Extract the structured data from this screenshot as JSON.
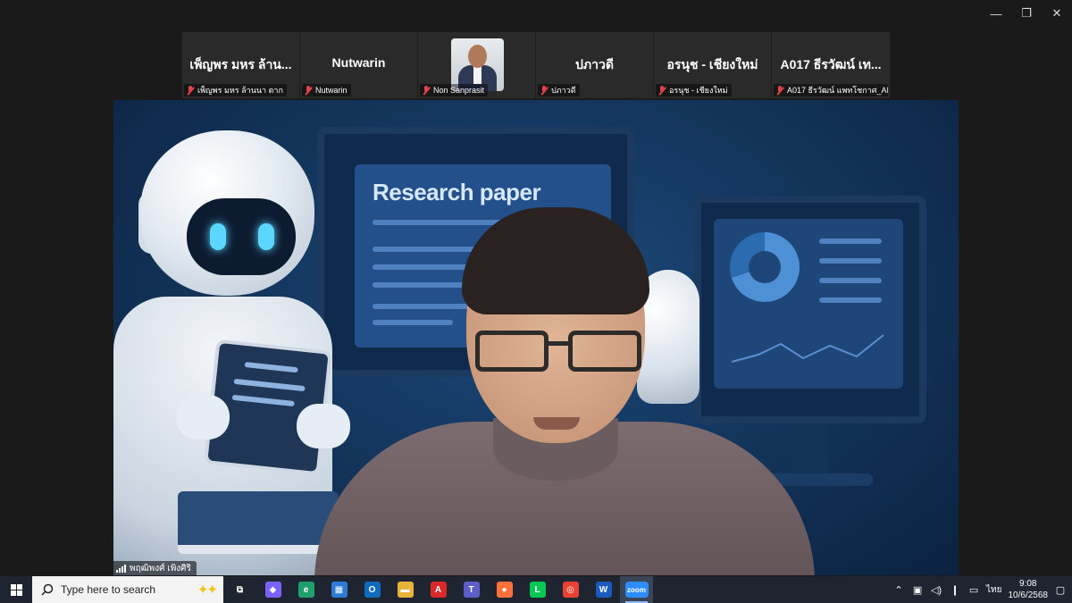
{
  "window": {
    "minimize": "—",
    "restore": "❐",
    "close": "✕"
  },
  "participants": [
    {
      "name": "เพ็ญพร มหร ล้าน...",
      "label": "เพ็ญพร มหร ล้านนา ตาก",
      "muted": true,
      "has_video": false
    },
    {
      "name": "Nutwarin",
      "label": "Nutwarin",
      "muted": true,
      "has_video": false
    },
    {
      "name": "",
      "label": "Non Sanprasit",
      "muted": true,
      "has_video": true
    },
    {
      "name": "ปภาวดี",
      "label": "ปภาวดี",
      "muted": true,
      "has_video": false
    },
    {
      "name": "อรนุช - เชียงใหม่",
      "label": "อรนุช - เชียงใหม่",
      "muted": true,
      "has_video": false
    },
    {
      "name": "A017 ธีรวัฒน์ เท...",
      "label": "A017 ธีรวัฒน์ แพทโชกาศ_AI...",
      "muted": true,
      "has_video": false
    }
  ],
  "main_video": {
    "speaker_label": "พฤฒิพงศ์ เพิงศิริ",
    "background_screen_title": "Research paper"
  },
  "taskbar": {
    "search_placeholder": "Type here to search",
    "apps": [
      {
        "icon": "task-view-icon",
        "glyph": "⧉",
        "color": "transparent"
      },
      {
        "icon": "copilot-icon",
        "glyph": "◆",
        "color": "#7b61ff"
      },
      {
        "icon": "edge-icon",
        "glyph": "e",
        "color": "#1f9e6e"
      },
      {
        "icon": "store-icon",
        "glyph": "▦",
        "color": "#2b7bd6"
      },
      {
        "icon": "outlook-icon",
        "glyph": "O",
        "color": "#0f6cbd"
      },
      {
        "icon": "file-explorer-icon",
        "glyph": "▬",
        "color": "#e8b33a"
      },
      {
        "icon": "acrobat-icon",
        "glyph": "A",
        "color": "#d9292b"
      },
      {
        "icon": "teams-icon",
        "glyph": "T",
        "color": "#5b5fc7"
      },
      {
        "icon": "firefox-icon",
        "glyph": "●",
        "color": "#ff7139"
      },
      {
        "icon": "line-icon",
        "glyph": "L",
        "color": "#06c755"
      },
      {
        "icon": "chrome-icon",
        "glyph": "◎",
        "color": "#e94235"
      },
      {
        "icon": "word-icon",
        "glyph": "W",
        "color": "#185abd"
      },
      {
        "icon": "zoom-icon",
        "glyph": "zoom",
        "color": "#2d8cff",
        "active": true
      }
    ],
    "language": "ไทย",
    "time": "9:08",
    "date": "10/6/2568"
  }
}
